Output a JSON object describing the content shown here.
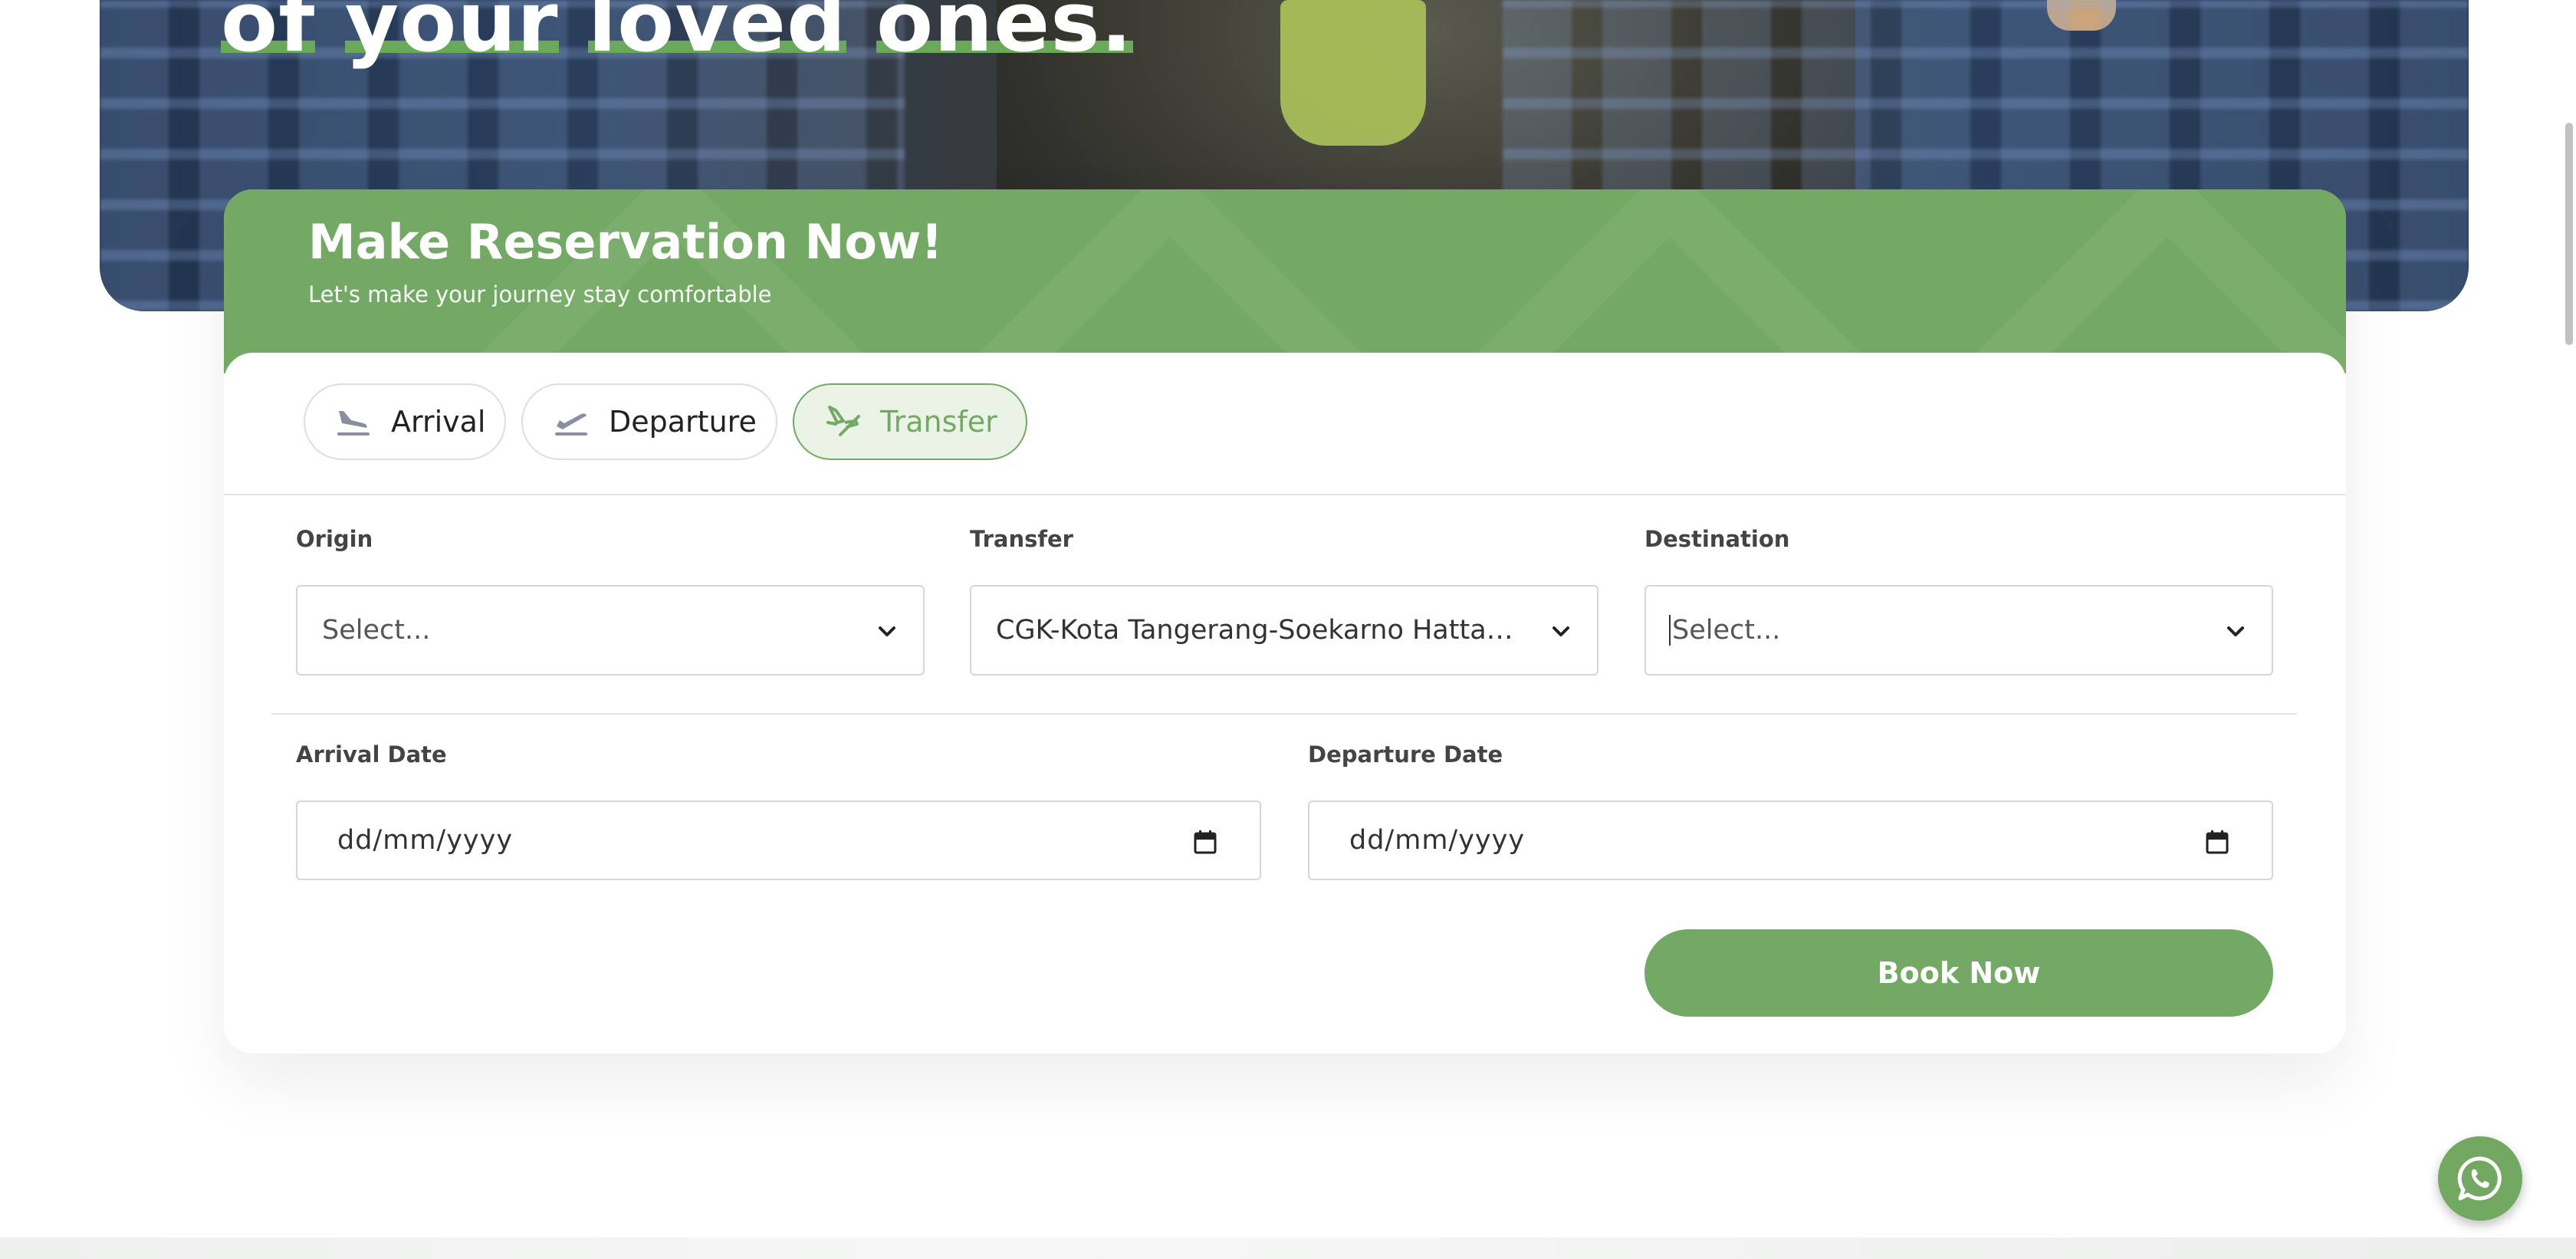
{
  "hero": {
    "title_words": [
      "of",
      "your",
      "loved",
      "ones."
    ]
  },
  "reservation": {
    "title": "Make Reservation Now!",
    "subtitle": "Let's make your journey stay comfortable",
    "tabs": [
      {
        "label": "Arrival",
        "icon": "plane-landing-icon",
        "active": false
      },
      {
        "label": "Departure",
        "icon": "plane-takeoff-icon",
        "active": false
      },
      {
        "label": "Transfer",
        "icon": "plane-transfer-icon",
        "active": true
      }
    ],
    "origin": {
      "label": "Origin",
      "value": "Select..."
    },
    "transfer": {
      "label": "Transfer",
      "value": "CGK-Kota Tangerang-Soekarno Hatta International Airport"
    },
    "destination": {
      "label": "Destination",
      "value": "Select..."
    },
    "arrival_date": {
      "label": "Arrival Date",
      "value": "dd/mm/yyyy"
    },
    "departure_date": {
      "label": "Departure Date",
      "value": "dd/mm/yyyy"
    },
    "book_label": "Book Now"
  },
  "colors": {
    "accent": "#74a965",
    "accent_light": "#eaf3e6",
    "border": "#d6d6d6"
  }
}
